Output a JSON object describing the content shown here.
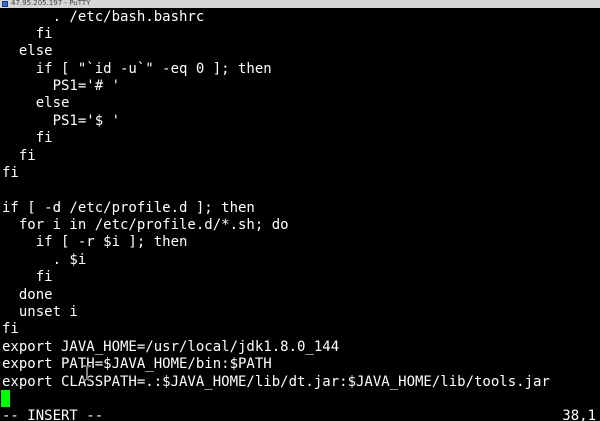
{
  "window": {
    "title": "47.95.205.197 - PuTTY"
  },
  "editor": {
    "lines": [
      "      . /etc/bash.bashrc",
      "    fi",
      "  else",
      "    if [ \"`id -u`\" -eq 0 ]; then",
      "      PS1='# '",
      "    else",
      "      PS1='$ '",
      "    fi",
      "  fi",
      "fi",
      "",
      "if [ -d /etc/profile.d ]; then",
      "  for i in /etc/profile.d/*.sh; do",
      "    if [ -r $i ]; then",
      "      . $i",
      "    fi",
      "  done",
      "  unset i",
      "fi",
      "export JAVA_HOME=/usr/local/jdk1.8.0_144",
      "export PATH=$JAVA_HOME/bin:$PATH",
      "export CLASSPATH=.:$JAVA_HOME/lib/dt.jar:$JAVA_HOME/lib/tools.jar"
    ],
    "cursor_color": "#00ff00"
  },
  "status": {
    "mode": "-- INSERT --",
    "position": "38,1"
  },
  "colors": {
    "background": "#000000",
    "text": "#ffffff",
    "cursor": "#00ff00"
  }
}
